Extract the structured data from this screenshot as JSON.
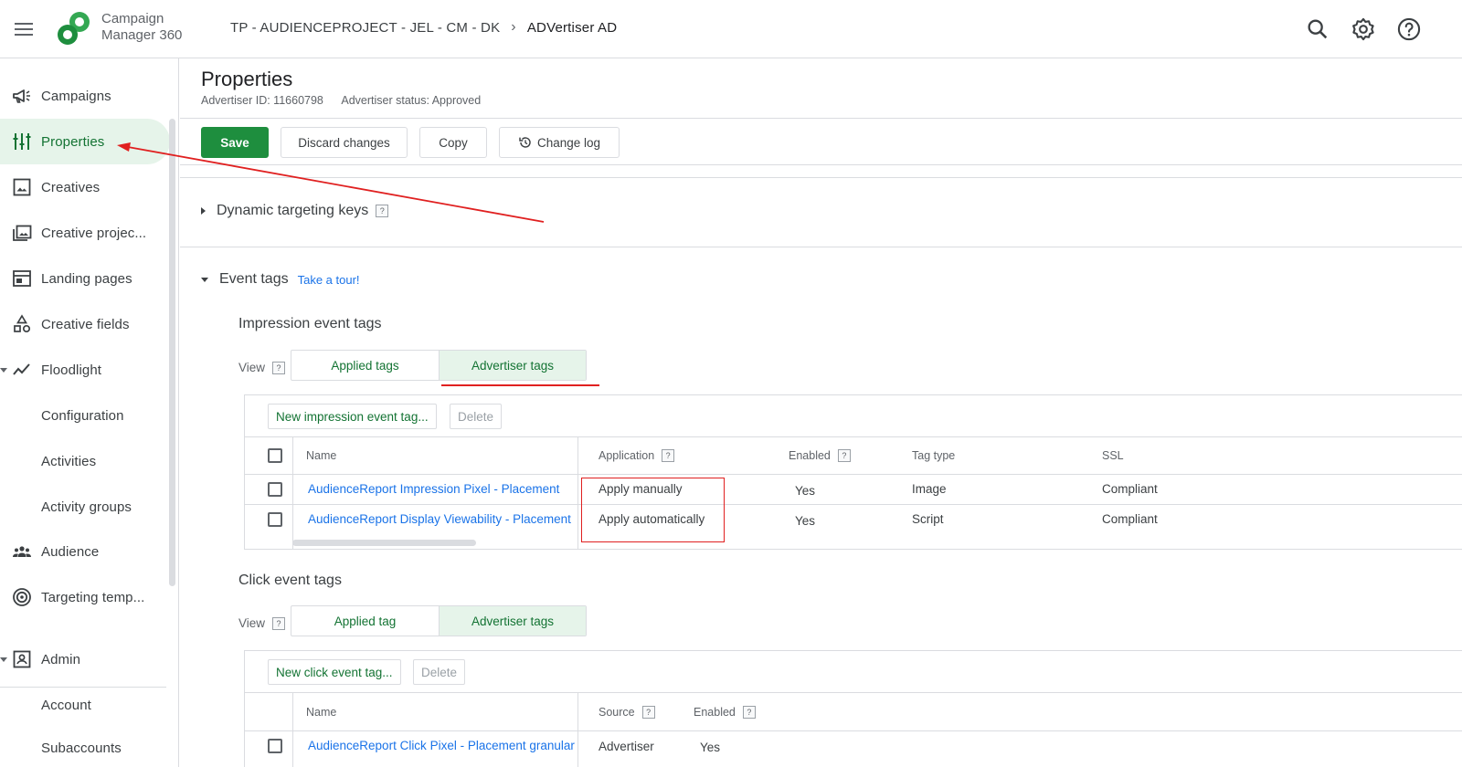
{
  "app": {
    "name_line1": "Campaign",
    "name_line2": "Manager 360"
  },
  "breadcrumb": {
    "parent": "TP - AUDIENCEPROJECT - JEL - CM - DK",
    "current": "ADVertiser AD"
  },
  "sidebar": {
    "items": [
      {
        "label": "Campaigns",
        "icon": "megaphone-icon"
      },
      {
        "label": "Properties",
        "icon": "sliders-icon",
        "active": true
      },
      {
        "label": "Creatives",
        "icon": "image-icon"
      },
      {
        "label": "Creative projec...",
        "icon": "image-stack-icon"
      },
      {
        "label": "Landing pages",
        "icon": "web-page-icon"
      },
      {
        "label": "Creative fields",
        "icon": "shapes-icon"
      },
      {
        "label": "Floodlight",
        "icon": "trend-line-icon"
      },
      {
        "label": "Configuration"
      },
      {
        "label": "Activities"
      },
      {
        "label": "Activity groups"
      },
      {
        "label": "Audience",
        "icon": "group-icon"
      },
      {
        "label": "Targeting temp...",
        "icon": "target-icon"
      },
      {
        "label": "Admin",
        "icon": "admin-badge-icon"
      },
      {
        "label": "Account"
      },
      {
        "label": "Subaccounts"
      }
    ]
  },
  "page": {
    "title": "Properties",
    "advertiser_id": "Advertiser ID: 11660798",
    "advertiser_status": "Advertiser status: Approved"
  },
  "toolbar": {
    "save": "Save",
    "discard": "Discard changes",
    "copy": "Copy",
    "changelog": "Change log"
  },
  "dynamic": {
    "title": "Dynamic targeting keys",
    "help": "?"
  },
  "event_tags": {
    "title": "Event tags",
    "tour_link": "Take a tour!",
    "impression": {
      "title": "Impression event tags",
      "view_label": "View",
      "tab_applied": "Applied tags",
      "tab_advertiser": "Advertiser tags",
      "new_btn": "New impression event tag...",
      "delete_btn": "Delete",
      "columns": [
        "Name",
        "Application",
        "Enabled",
        "Tag type",
        "SSL"
      ],
      "rows": [
        {
          "name": "AudienceReport Impression Pixel - Placement",
          "application": "Apply manually",
          "enabled": "Yes",
          "tag_type": "Image",
          "ssl": "Compliant"
        },
        {
          "name": "AudienceReport Display Viewability - Placement",
          "application": "Apply automatically",
          "enabled": "Yes",
          "tag_type": "Script",
          "ssl": "Compliant"
        }
      ]
    },
    "click": {
      "title": "Click event tags",
      "view_label": "View",
      "tab_applied": "Applied tag",
      "tab_advertiser": "Advertiser tags",
      "new_btn": "New click event tag...",
      "delete_btn": "Delete",
      "columns": [
        "Name",
        "Source",
        "Enabled"
      ],
      "rows": [
        {
          "name": "AudienceReport Click Pixel - Placement granular",
          "source": "Advertiser",
          "enabled": "Yes"
        }
      ]
    }
  },
  "colors": {
    "accent_green": "#1e8e3e",
    "link_blue": "#1a73e8",
    "annotation_red": "#e02020"
  }
}
